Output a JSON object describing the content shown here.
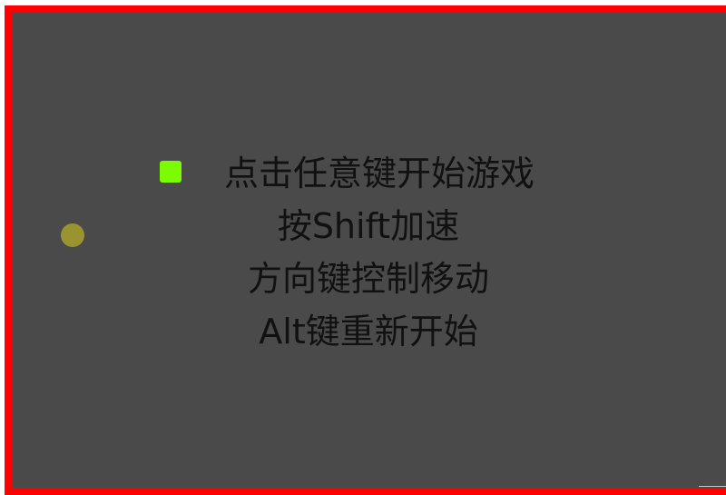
{
  "game": {
    "colors": {
      "border": "#ff0000",
      "background": "#4a4a4a",
      "player": "#7cfc00",
      "food": "#9a9430",
      "text": "#111111"
    },
    "instructions": {
      "start": "点击任意键开始游戏",
      "speed": "按Shift加速",
      "move": "方向键控制移动",
      "restart": "Alt键重新开始"
    }
  }
}
